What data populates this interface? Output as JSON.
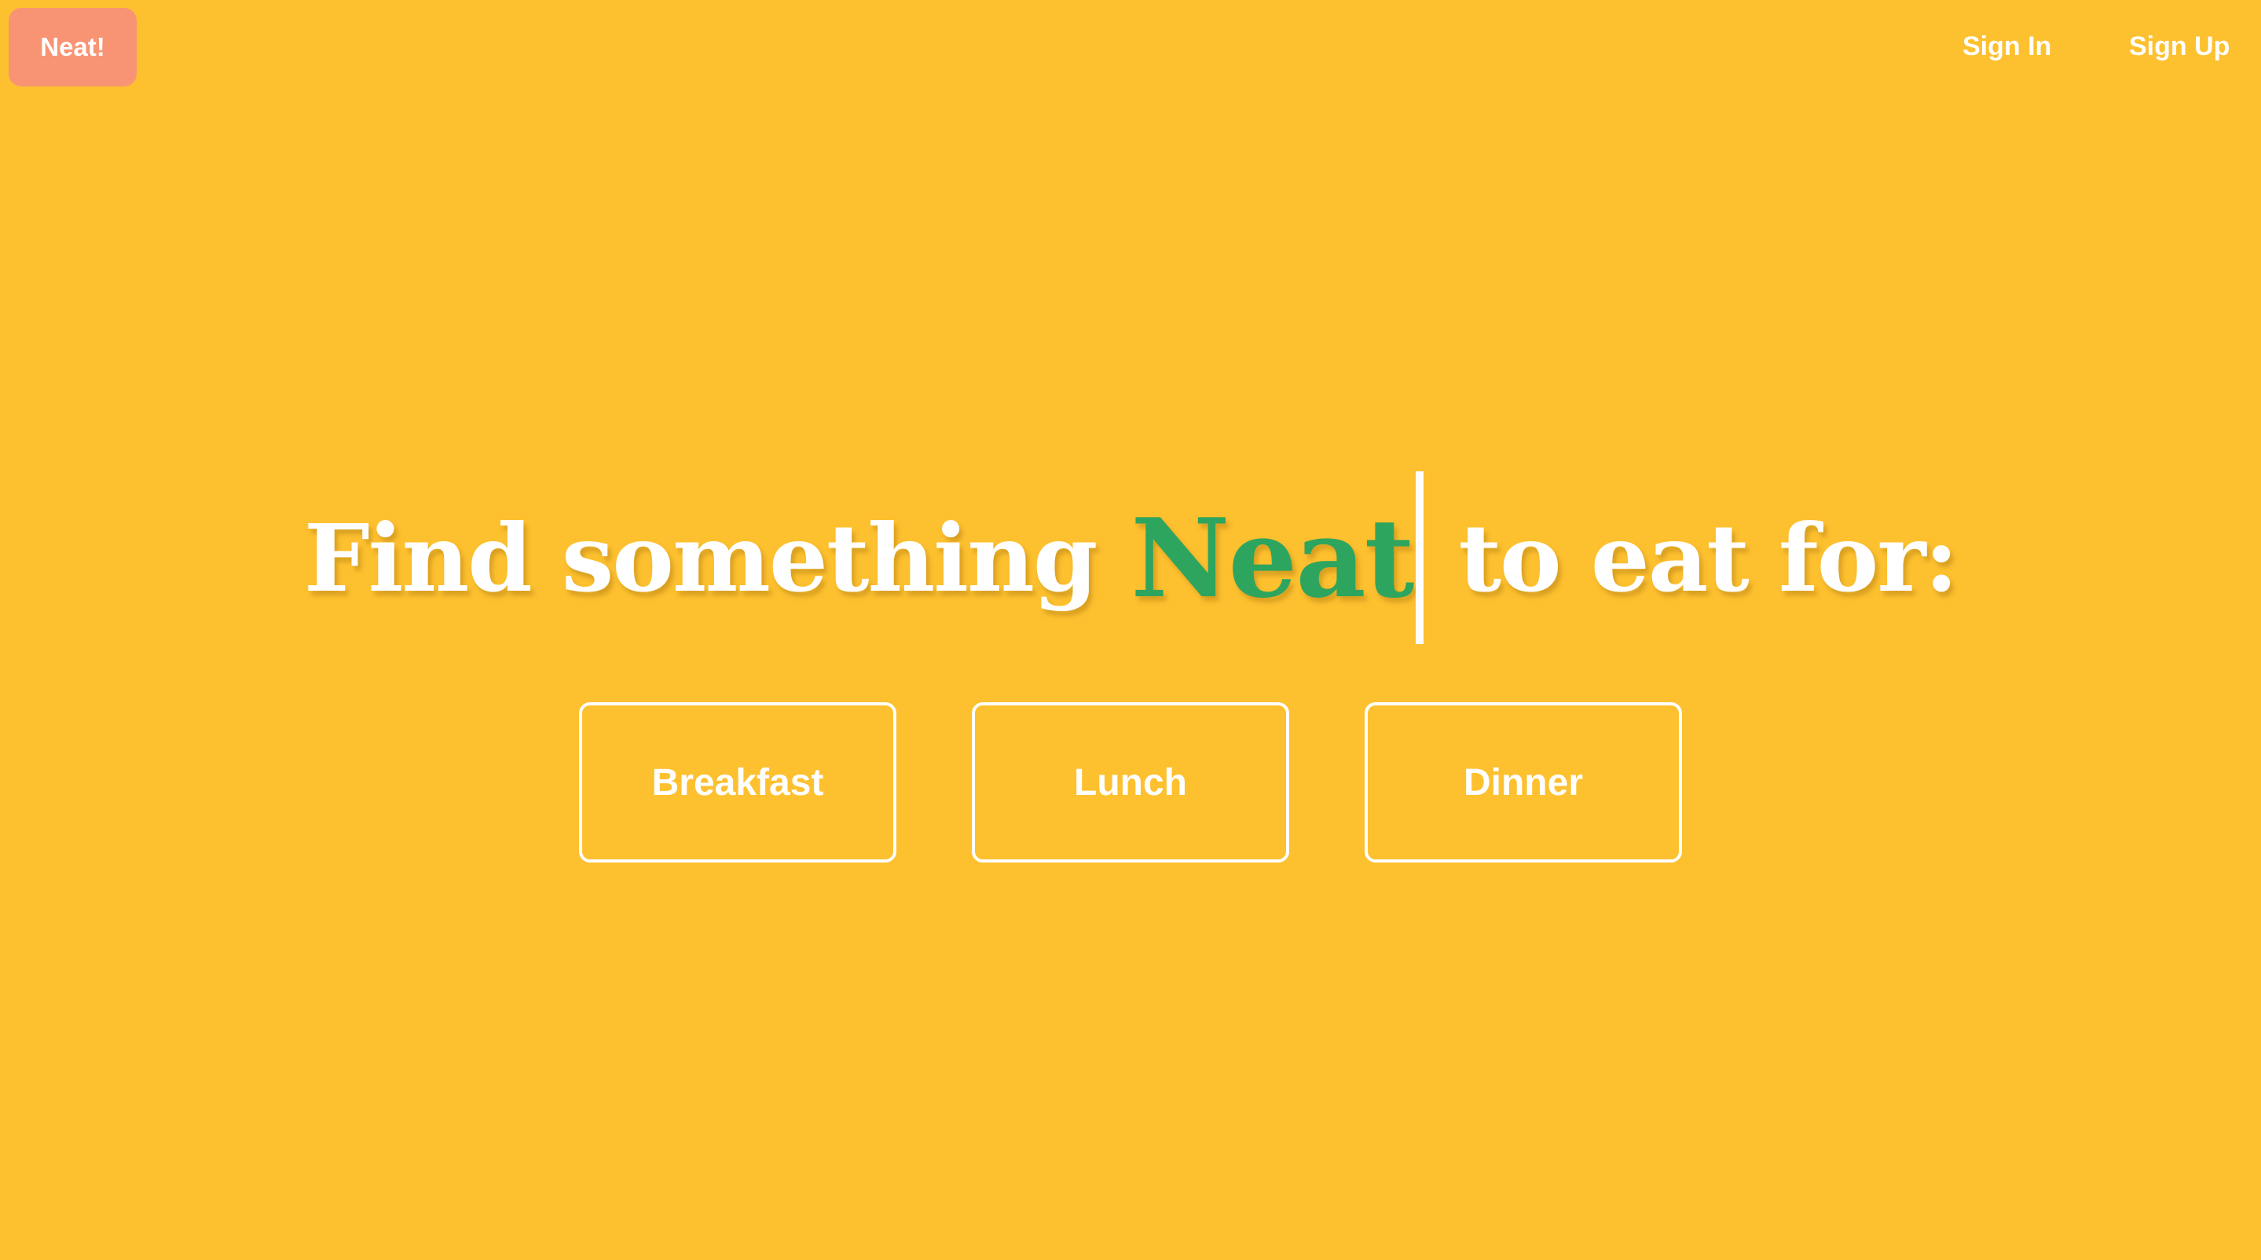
{
  "header": {
    "brand_label": "Neat!",
    "sign_in_label": "Sign In",
    "sign_up_label": "Sign Up"
  },
  "hero": {
    "headline_prefix": "Find something",
    "headline_accent": "Neat",
    "headline_suffix": "to eat for:"
  },
  "meals": {
    "breakfast_label": "Breakfast",
    "lunch_label": "Lunch",
    "dinner_label": "Dinner"
  },
  "colors": {
    "background": "#fdc02f",
    "brand_button": "#f89473",
    "accent_text": "#2ea55e",
    "foreground": "#ffffff"
  }
}
